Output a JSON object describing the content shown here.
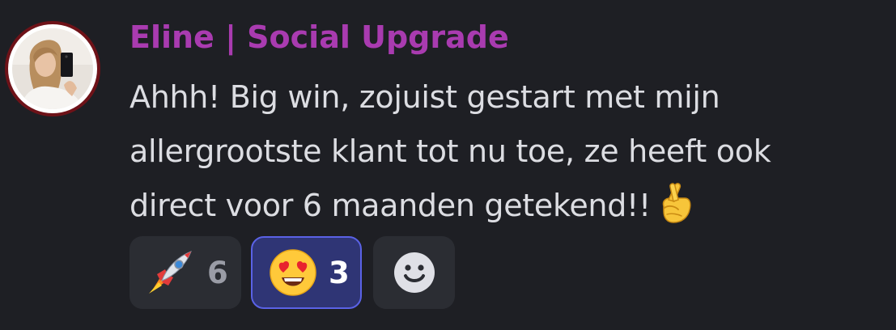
{
  "message": {
    "username": "Eline | Social Upgrade",
    "username_color": "#a93bb0",
    "lines": [
      "Ahhh! Big win, zojuist gestart met mijn",
      "allergrootste klant tot nu toe, ze heeft ook",
      "direct voor 6 maanden getekend!!"
    ],
    "trailing_emoji": "crossed-fingers"
  },
  "reactions": [
    {
      "emoji": "rocket",
      "count": "6",
      "selected": false
    },
    {
      "emoji": "smiling-face-with-heart-eyes",
      "count": "3",
      "selected": true
    }
  ],
  "add_reaction": {
    "icon": "add-reaction-smiley"
  },
  "colors": {
    "background": "#1e1f24",
    "text": "#dcdde2",
    "selected_reaction_bg": "#2f3575",
    "selected_reaction_border": "#5a62e6",
    "reaction_bg": "#2b2d33"
  }
}
